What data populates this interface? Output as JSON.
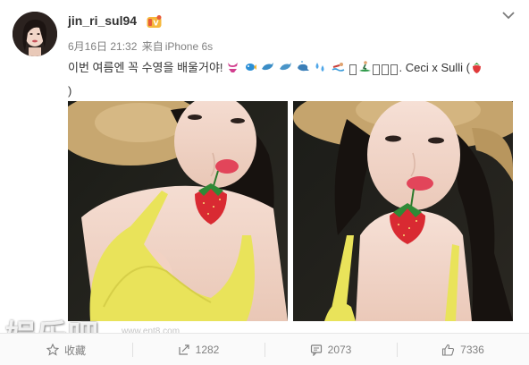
{
  "header": {
    "username": "jin_ri_sul94",
    "date": "6月16日 21:32",
    "source_prefix": "来自",
    "source": "iPhone 6s"
  },
  "post": {
    "text_part1": "이번 여름엔 꼭 수영을 배울거야!",
    "text_part2": ". Ceci x Sulli (",
    "text_part3": ")",
    "emojis": [
      "bikini",
      "tropical-fish",
      "dolphin",
      "dolphin",
      "whale",
      "sweat-droplets",
      "swimmer",
      "missing-glyph",
      "surfer",
      "missing-glyph",
      "missing-glyph",
      "missing-glyph",
      "strawberry"
    ]
  },
  "watermark": {
    "logo_text": "娱乐吧",
    "url": "www.ent8.com"
  },
  "actions": {
    "favorite_label": "收藏",
    "repost_count": "1282",
    "comment_count": "2073",
    "like_count": "7336"
  },
  "colors": {
    "muted_text": "#808080",
    "body_text": "#333333",
    "action_bar_bg": "#fafafa",
    "divider": "#e6e6e6"
  }
}
